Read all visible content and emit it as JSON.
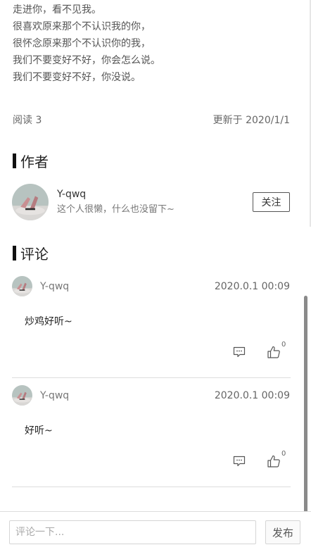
{
  "poem": {
    "lines": [
      "走进你，看不见我。",
      "很喜欢原来那个不认识我的你，",
      "很怀念原来那个不认识你的我，",
      "我们不要变好不好，你会怎么说。",
      "我们不要变好不好，你没说。"
    ]
  },
  "meta": {
    "read_text": "阅读 3",
    "updated_text": "更新于 2020/1/1"
  },
  "author_section": {
    "title": "作者",
    "name": "Y-qwq",
    "description": "这个人很懒，什么也没留下~",
    "follow_label": "关注"
  },
  "comments_section": {
    "title": "评论",
    "comments": [
      {
        "user": "Y-qwq",
        "time": "2020.0.1 00:09",
        "text": "炒鸡好听~",
        "likes": "0"
      },
      {
        "user": "Y-qwq",
        "time": "2020.0.1 00:09",
        "text": "好听~",
        "likes": "0"
      }
    ]
  },
  "input_bar": {
    "placeholder": "评论一下...",
    "value": "",
    "post_label": "发布"
  },
  "icons": {
    "avatar": "avatar-image",
    "reply": "comment-bubble-icon",
    "like": "thumbs-up-icon"
  },
  "colors": {
    "accent_bar": "#111111",
    "scrollbar": "#8a8a8a"
  }
}
